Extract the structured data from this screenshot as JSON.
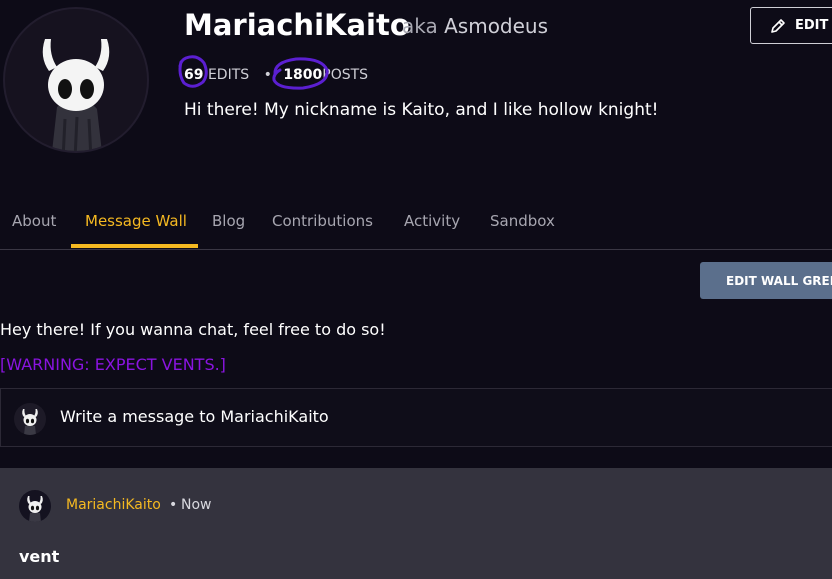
{
  "profile": {
    "username": "MariachiKaito",
    "aka_word": "aka",
    "aka_name": "Asmodeus",
    "edits_count": "69",
    "edits_label": "EDITS",
    "separator": "•",
    "posts_count": "1800",
    "posts_label": "POSTS",
    "bio": "Hi there! My nickname is Kaito, and I like hollow knight!",
    "edit_label": "EDIT"
  },
  "tabs": [
    {
      "label": "About"
    },
    {
      "label": "Message Wall"
    },
    {
      "label": "Blog"
    },
    {
      "label": "Contributions"
    },
    {
      "label": "Activity"
    },
    {
      "label": "Sandbox"
    }
  ],
  "active_tab": "Message Wall",
  "wall": {
    "edit_wall_label": "EDIT WALL GREETING",
    "greeting": "Hey there! If you wanna chat, feel free to do so!",
    "warning": "[WARNING: EXPECT VENTS.]",
    "compose_placeholder": "Write a message to MariachiKaito"
  },
  "post": {
    "author": "MariachiKaito",
    "dot": "•",
    "time": "Now",
    "title": "vent"
  },
  "colors": {
    "accent": "#f5b921",
    "background": "#0d0b17",
    "warning": "#8a14e0",
    "annotation": "#5b1fd1",
    "wall_button": "#5b6f8c",
    "post_bg": "#34333e"
  },
  "icons": [
    "pencil-icon",
    "hollow-knight-avatar"
  ]
}
